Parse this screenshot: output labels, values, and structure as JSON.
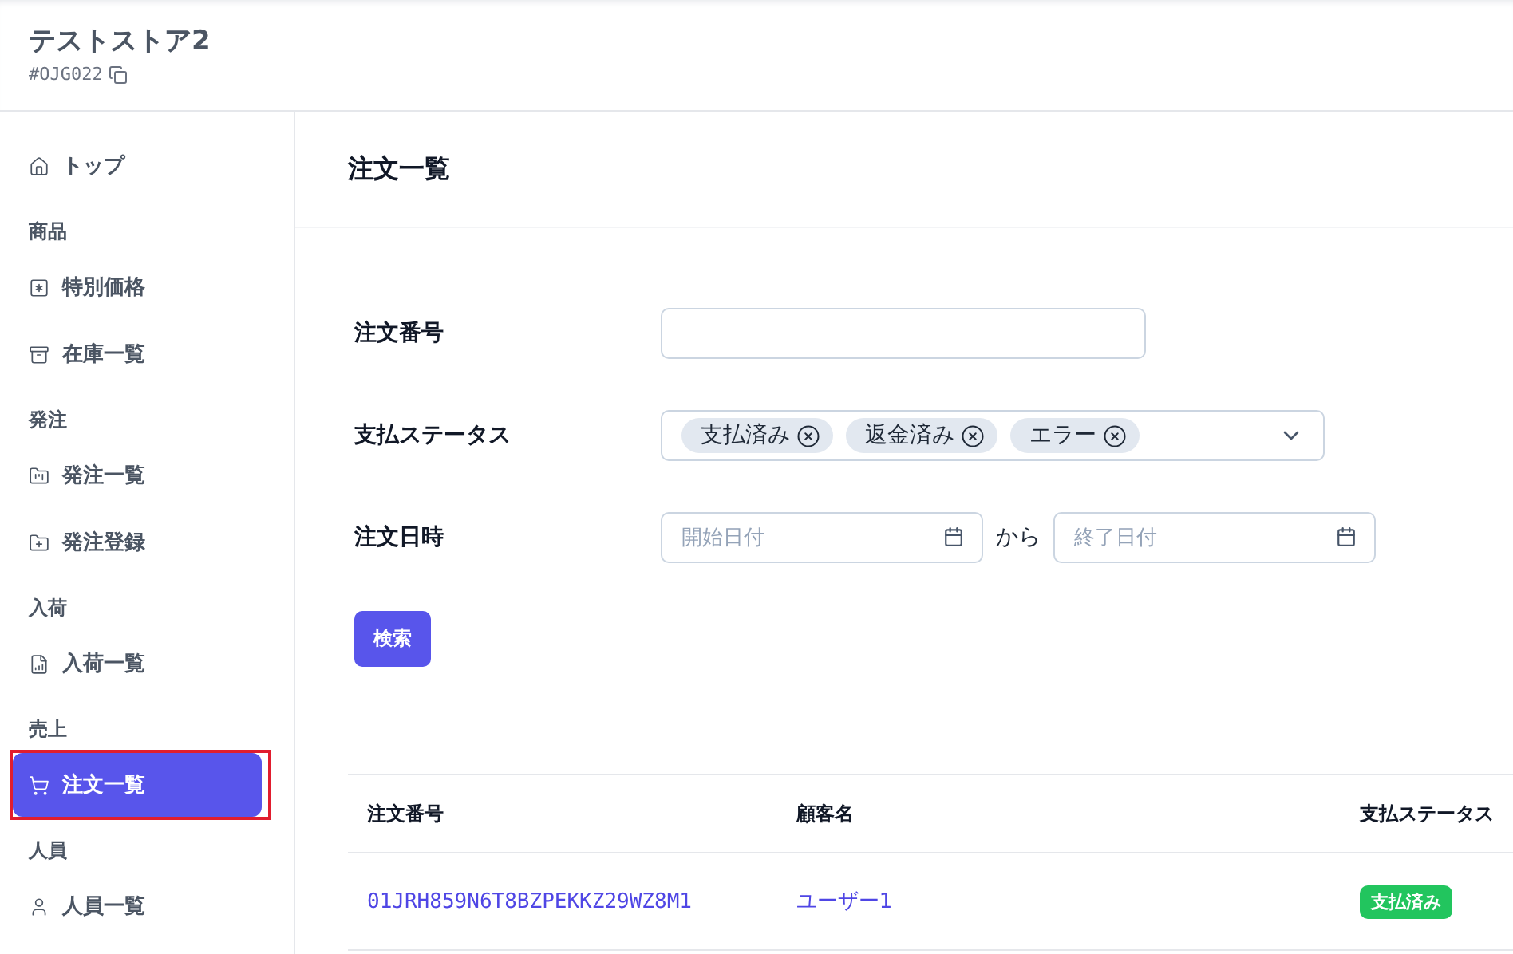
{
  "store": {
    "name": "テストストア2",
    "code": "#OJG022"
  },
  "sidebar": {
    "items": [
      {
        "kind": "link",
        "label": "トップ",
        "selected": false
      },
      {
        "kind": "section",
        "label": "商品"
      },
      {
        "kind": "link",
        "label": "特別価格",
        "selected": false
      },
      {
        "kind": "link",
        "label": "在庫一覧",
        "selected": false
      },
      {
        "kind": "section",
        "label": "発注"
      },
      {
        "kind": "link",
        "label": "発注一覧",
        "selected": false
      },
      {
        "kind": "link",
        "label": "発注登録",
        "selected": false
      },
      {
        "kind": "section",
        "label": "入荷"
      },
      {
        "kind": "link",
        "label": "入荷一覧",
        "selected": false
      },
      {
        "kind": "section",
        "label": "売上"
      },
      {
        "kind": "link",
        "label": "注文一覧",
        "selected": true
      },
      {
        "kind": "section",
        "label": "人員"
      },
      {
        "kind": "link",
        "label": "人員一覧",
        "selected": false
      }
    ]
  },
  "page_title": "注文一覧",
  "form": {
    "order_number": {
      "label": "注文番号"
    },
    "payment_status": {
      "label": "支払ステータス",
      "tags": [
        "支払済み",
        "返金済み",
        "エラー"
      ]
    },
    "order_date": {
      "label": "注文日時",
      "start_placeholder": "開始日付",
      "separator": "から",
      "end_placeholder": "終了日付"
    },
    "search_button": "検索"
  },
  "table": {
    "columns": [
      "注文番号",
      "顧客名",
      "支払ステータス"
    ],
    "rows": [
      {
        "order_number": "01JRH859N6T8BZPEKKZ29WZ8M1",
        "customer": "ユーザー1",
        "status": "支払済み"
      }
    ]
  }
}
